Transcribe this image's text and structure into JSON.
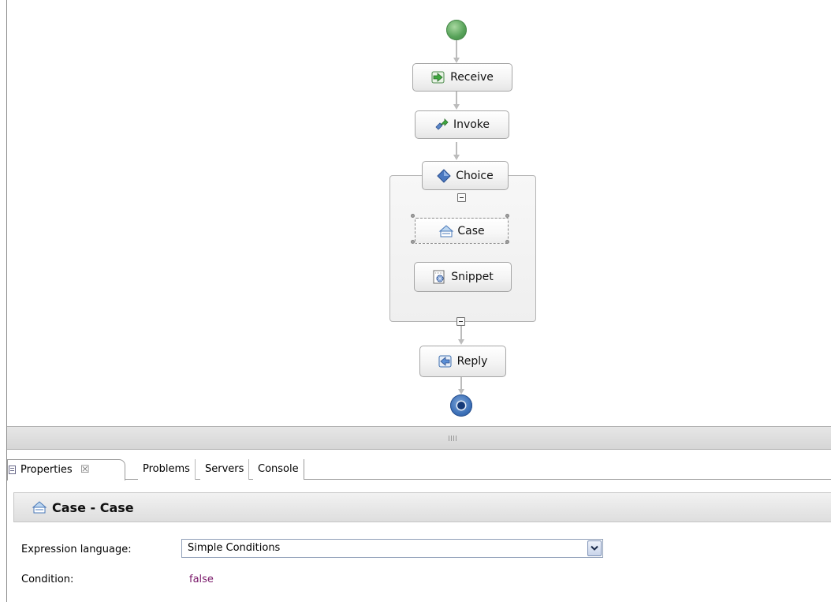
{
  "process": {
    "start": "start-node",
    "receive_label": "Receive",
    "invoke_label": "Invoke",
    "choice_label": "Choice",
    "case_label": "Case",
    "snippet_label": "Snippet",
    "reply_label": "Reply",
    "end": "end-node"
  },
  "views": {
    "tabs": [
      {
        "label": "Properties",
        "active": true,
        "close": "☒"
      },
      {
        "label": "Problems"
      },
      {
        "label": "Servers"
      },
      {
        "label": "Console"
      }
    ]
  },
  "properties": {
    "title": "Case - Case",
    "expression_language_label": "Expression language:",
    "expression_language_value": "Simple Conditions",
    "condition_label": "Condition:",
    "condition_value": "false"
  },
  "icons": {
    "receive": "arrow-in-icon",
    "invoke": "invoke-icon",
    "choice": "diamond-icon",
    "case": "case-icon",
    "snippet": "snippet-icon",
    "reply": "reply-icon"
  },
  "colors": {
    "start_node": "#58a35a",
    "end_node": "#3b6fb7",
    "condition_value": "#7a1a6a"
  }
}
